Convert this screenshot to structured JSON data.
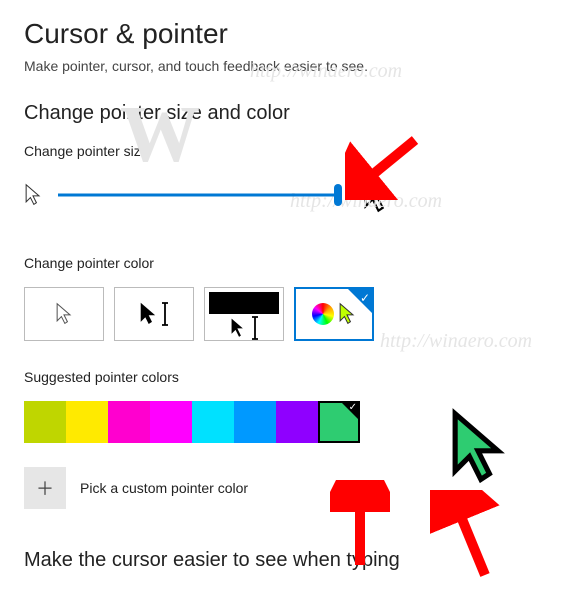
{
  "page": {
    "title": "Cursor & pointer",
    "description": "Make pointer, cursor, and touch feedback easier to see."
  },
  "section_size_color": {
    "title": "Change pointer size and color",
    "size_label": "Change pointer size",
    "color_label": "Change pointer color"
  },
  "pointer_color_options": [
    {
      "id": "white",
      "selected": false
    },
    {
      "id": "black",
      "selected": false
    },
    {
      "id": "inverted",
      "selected": false
    },
    {
      "id": "custom",
      "selected": true
    }
  ],
  "suggested": {
    "label": "Suggested pointer colors",
    "colors": [
      {
        "hex": "#bfd600",
        "selected": false
      },
      {
        "hex": "#ffea00",
        "selected": false
      },
      {
        "hex": "#ff00cf",
        "selected": false
      },
      {
        "hex": "#ff00ff",
        "selected": false
      },
      {
        "hex": "#00e1ff",
        "selected": false
      },
      {
        "hex": "#0099ff",
        "selected": false
      },
      {
        "hex": "#8f00ff",
        "selected": false
      },
      {
        "hex": "#2ecc71",
        "selected": true
      }
    ]
  },
  "custom_color": {
    "label": "Pick a custom pointer color"
  },
  "section_typing": {
    "title": "Make the cursor easier to see when typing"
  },
  "watermark": {
    "letter": "W",
    "url": "http://winaero.com"
  }
}
